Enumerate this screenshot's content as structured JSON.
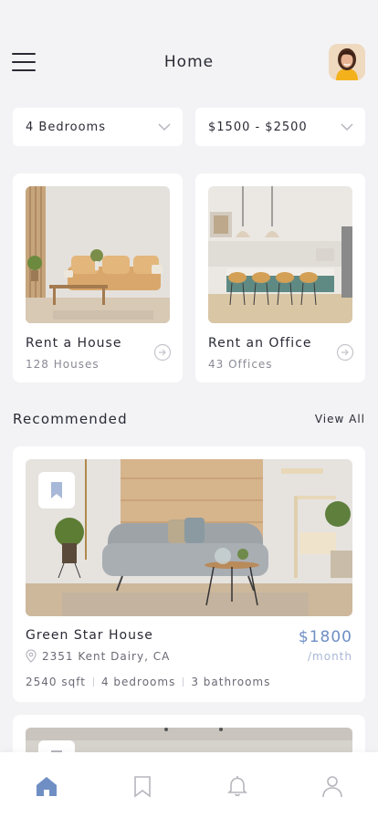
{
  "header": {
    "title": "Home"
  },
  "filters": {
    "bedrooms": "4 Bedrooms",
    "price_range": "$1500 - $2500"
  },
  "categories": [
    {
      "title": "Rent a House",
      "subtitle": "128 Houses"
    },
    {
      "title": "Rent an Office",
      "subtitle": "43 Offices"
    }
  ],
  "recommended": {
    "section_title": "Recommended",
    "view_all_label": "View All",
    "items": [
      {
        "name": "Green Star House",
        "address": "2351 Kent Dairy, CA",
        "price": "$1800",
        "period": "/month",
        "area": "2540 sqft",
        "bedrooms": "4 bedrooms",
        "bathrooms": "3 bathrooms"
      }
    ]
  },
  "colors": {
    "accent": "#6f8fc4",
    "background": "#f3f3f5",
    "card": "#ffffff",
    "text": "#2a2a35",
    "muted": "#8a8a95"
  },
  "tabbar": {
    "icons": [
      "home-icon",
      "bookmark-icon",
      "bell-icon",
      "user-icon"
    ],
    "active": "home-icon"
  }
}
